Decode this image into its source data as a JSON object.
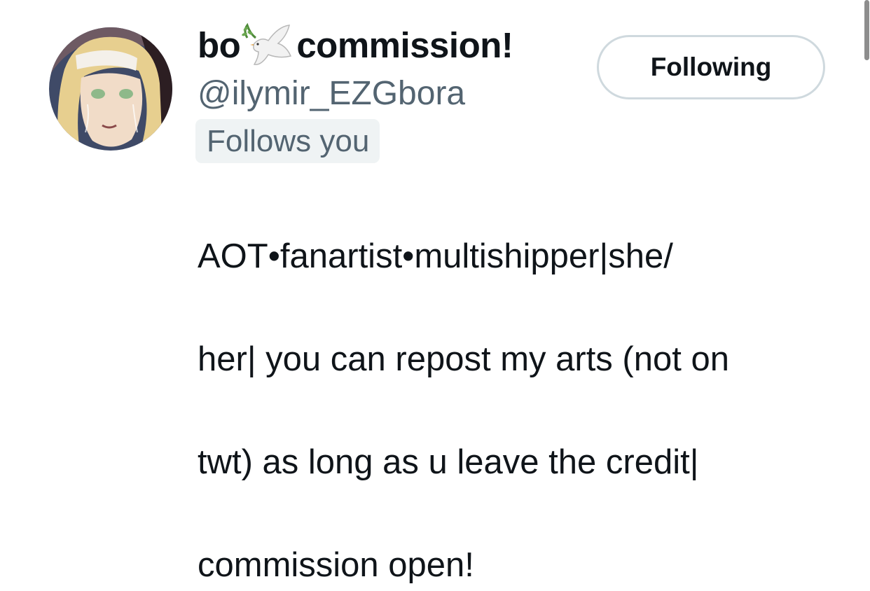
{
  "profile": {
    "display_name_prefix": "bo",
    "display_name_suffix": "commission!",
    "name_icon": "dove-with-olive-branch-icon",
    "handle": "@ilymir_EZGbora",
    "follows_you": "Follows you",
    "follow_button": "Following",
    "bio_lines": [
      "AOT•fanartist•multishipper|she/",
      "her| you can repost my arts (not on",
      "twt) as long as u leave the credit|",
      "commission open!"
    ]
  },
  "colors": {
    "text_primary": "#0f1419",
    "text_secondary": "#536471",
    "badge_bg": "#eff3f4",
    "button_border": "#cfd9de",
    "scrollbar": "#8d8d8d"
  }
}
